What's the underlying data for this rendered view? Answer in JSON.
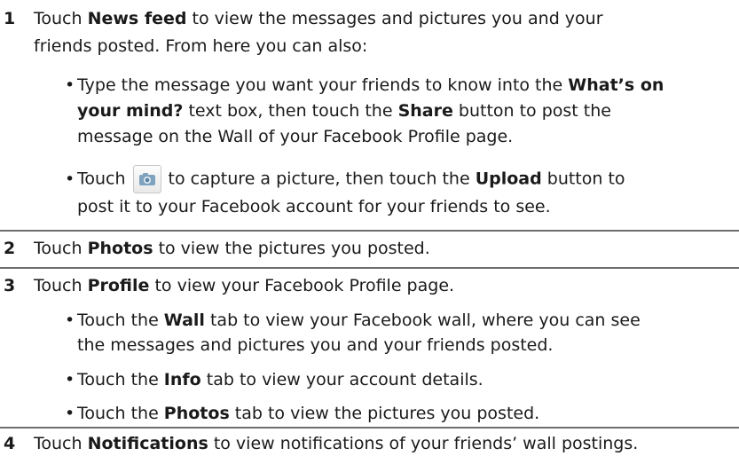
{
  "steps": [
    {
      "number": "1",
      "line1_a": "Touch ",
      "line1_b": "News feed",
      "line1_c": " to view the messages and pictures you and your",
      "line2": "friends posted. From here you can also:",
      "bullets": [
        {
          "l1_a": "Type the message you want your friends to know into the ",
          "l1_b": "What’s on",
          "l2_a": "your mind?",
          "l2_b": " text box, then touch the ",
          "l2_c": "Share",
          "l2_d": " button to post the",
          "l3": "message on the Wall of your Facebook Profile page."
        },
        {
          "l1_a": "Touch",
          "l1_b": "to capture a picture, then touch the ",
          "l1_c": "Upload",
          "l1_d": " button to",
          "l2": "post it to your Facebook account for your friends to see."
        }
      ]
    },
    {
      "number": "2",
      "a": "Touch ",
      "b": "Photos",
      "c": " to view the pictures you posted."
    },
    {
      "number": "3",
      "a": "Touch ",
      "b": "Profile",
      "c": " to view your Facebook Profile page.",
      "bullets": [
        {
          "l1_a": "Touch the ",
          "l1_b": "Wall",
          "l1_c": " tab to view your Facebook wall, where you can see",
          "l2": "the messages and pictures you and your friends posted."
        },
        {
          "l1_a": "Touch the ",
          "l1_b": "Info",
          "l1_c": " tab to view your account details."
        },
        {
          "l1_a": "Touch the ",
          "l1_b": "Photos",
          "l1_c": " tab to view the pictures you posted."
        }
      ]
    },
    {
      "number": "4",
      "a": "Touch ",
      "b": "Notifications",
      "c": " to view notifications of your friends’ wall postings."
    }
  ],
  "camera_icon": "camera-icon",
  "colors": {
    "text": "#1a1a1a",
    "rule": "#6e6e6e"
  }
}
